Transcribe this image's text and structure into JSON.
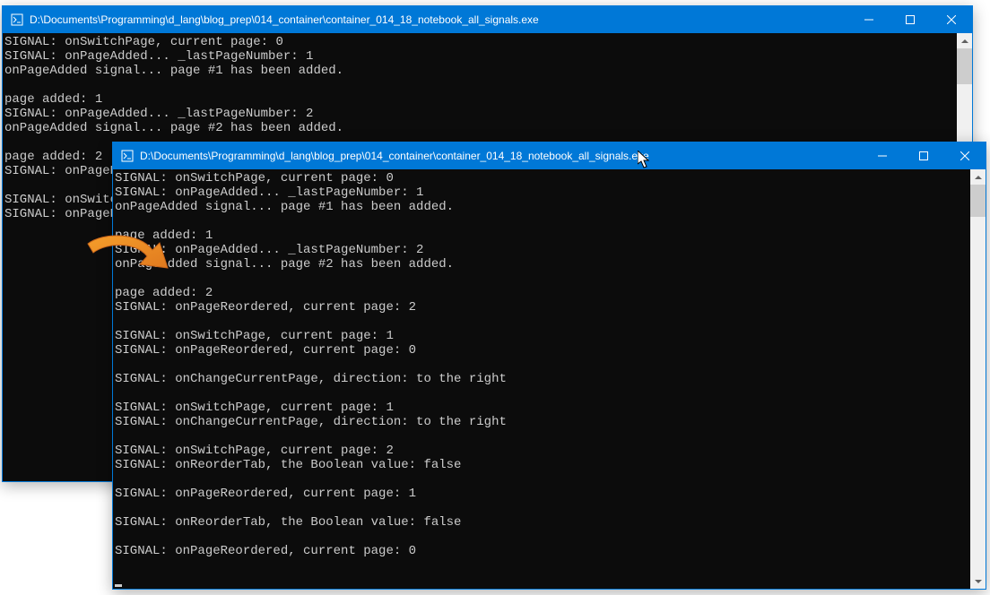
{
  "windowBack": {
    "title": "D:\\Documents\\Programming\\d_lang\\blog_prep\\014_container\\container_014_18_notebook_all_signals.exe",
    "lines": [
      "SIGNAL: onSwitchPage, current page: 0",
      "SIGNAL: onPageAdded... _lastPageNumber: 1",
      "onPageAdded signal... page #1 has been added.",
      "",
      "page added: 1",
      "SIGNAL: onPageAdded... _lastPageNumber: 2",
      "onPageAdded signal... page #2 has been added.",
      "",
      "page added: 2",
      "SIGNAL: onPageRe",
      "",
      "SIGNAL: onSwitch",
      "SIGNAL: onPageRe"
    ]
  },
  "windowFront": {
    "title": "D:\\Documents\\Programming\\d_lang\\blog_prep\\014_container\\container_014_18_notebook_all_signals.exe",
    "lines": [
      "SIGNAL: onSwitchPage, current page: 0",
      "SIGNAL: onPageAdded... _lastPageNumber: 1",
      "onPageAdded signal... page #1 has been added.",
      "",
      "page added: 1",
      "SIGNAL: onPageAdded... _lastPageNumber: 2",
      "onPageAdded signal... page #2 has been added.",
      "",
      "page added: 2",
      "SIGNAL: onPageReordered, current page: 2",
      "",
      "SIGNAL: onSwitchPage, current page: 1",
      "SIGNAL: onPageReordered, current page: 0",
      "",
      "SIGNAL: onChangeCurrentPage, direction: to the right",
      "",
      "SIGNAL: onSwitchPage, current page: 1",
      "SIGNAL: onChangeCurrentPage, direction: to the right",
      "",
      "SIGNAL: onSwitchPage, current page: 2",
      "SIGNAL: onReorderTab, the Boolean value: false",
      "",
      "SIGNAL: onPageReordered, current page: 1",
      "",
      "SIGNAL: onReorderTab, the Boolean value: false",
      "",
      "SIGNAL: onPageReordered, current page: 0",
      ""
    ]
  },
  "scroll": {
    "back": {
      "thumbTop": 17,
      "thumbHeight": 40
    },
    "front": {
      "thumbTop": 17,
      "thumbHeight": 36
    }
  }
}
